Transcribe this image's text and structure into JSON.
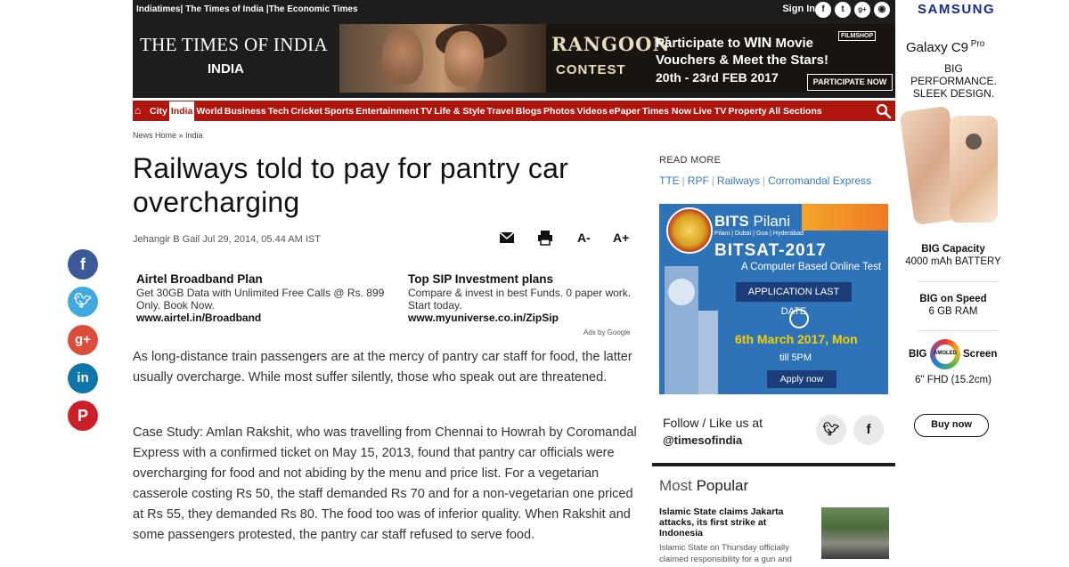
{
  "topbar": {
    "links": [
      "Indiatimes|",
      "The Times of India",
      "|The Economic Times"
    ],
    "signin": "Sign In",
    "social_icons": [
      "facebook-icon",
      "twitter-icon",
      "google-plus-icon",
      "rss-icon"
    ]
  },
  "masthead": {
    "title": "THE TIMES OF INDIA",
    "edition": "INDIA"
  },
  "banner": {
    "movie": "RANGOON",
    "contest": "CONTEST",
    "promo_line1_pre": "Participate to ",
    "promo_win": "WIN",
    "promo_line1_post": " Movie",
    "promo_line2": "Vouchers & Meet the Stars!",
    "dates": "20th - 23rd FEB 2017",
    "sponsor": "FILMSHOP",
    "cta": "PARTICIPATE NOW"
  },
  "nav": {
    "items": [
      "City",
      "India",
      "World",
      "Business",
      "Tech",
      "Cricket",
      "Sports",
      "Entertainment",
      "TV",
      "Life & Style",
      "Travel",
      "Blogs",
      "Photos",
      "Videos",
      "ePaper",
      "Times Now",
      "Live TV",
      "Property",
      "All Sections"
    ],
    "active": "India",
    "colors": {
      "nav_bg": "#b0150e"
    }
  },
  "breadcrumb": "News Home » India",
  "article": {
    "headline": "Railways told to pay for pantry car overcharging",
    "byline": "Jehangir B Gail Jul 29, 2014, 05.44 AM IST",
    "tools": {
      "font_down": "A-",
      "font_up": "A+"
    },
    "paragraphs": [
      "As long-distance train passengers are at the mercy of pantry car staff for food, the latter usually overcharge. While most suffer silently, those who speak out are threatened.",
      "Case Study: Amlan Rakshit, who was travelling from Chennai to Howrah by Coromandal Express with a confirmed ticket on May 15, 2013, found that pantry car officials were overcharging for food and not abiding by the menu and price list. For a vegetarian casserole costing Rs 50, the staff demanded Rs 70 and for a non-vegetarian one priced at Rs 55, they demanded Rs 80. The food too was of inferior quality. When Rakshit and some passengers protested, the pantry car staff refused to serve food."
    ]
  },
  "ads": [
    {
      "title": "Airtel Broadband Plan",
      "desc": "Get 30GB Data with Unlimited Free Calls @ Rs. 899 Only. Book Now.",
      "url": "www.airtel.in/Broadband"
    },
    {
      "title": "Top SIP Investment plans",
      "desc": "Compare & invest in best Funds. 0 paper work. Start today.",
      "url": "www.myuniverse.co.in/ZipSip"
    }
  ],
  "ads_by": "Ads by Google",
  "read_more": {
    "title": "READ MORE",
    "links": [
      "TTE",
      "RPF",
      "Railways",
      "Corromandal Express"
    ]
  },
  "bits_ad": {
    "name": "BITS",
    "name2": " Pilani",
    "campuses": "Pilani | Dubai | Goa | Hyderabad",
    "exam": "BITSAT-2017",
    "subtitle": "A Computer Based Online Test",
    "last_date_label": "APPLICATION LAST DATE",
    "date": "6th March 2017, Mon",
    "time": "till 5PM",
    "cta": "Apply now"
  },
  "follow": {
    "line1": "Follow / Like us at",
    "handle": "@timesofindia"
  },
  "most_popular": {
    "title_a": "Most",
    "title_b": " Popular",
    "headline": "Islamic State claims Jakarta attacks, its first strike at Indonesia",
    "summary": "Islamic State on Thursday officially claimed responsibility for a gun and"
  },
  "samsung_ad": {
    "brand": "SAMSUNG",
    "model": "Galaxy C9",
    "model_sup": " Pro",
    "tagline": "BIG PERFORMANCE. SLEEK DESIGN.",
    "spec1_title": "BIG Capacity",
    "spec1_value": "4000 mAh BATTERY",
    "spec2_title": "BIG on Speed",
    "spec2_value": "6 GB RAM",
    "spec3_pre": "BIG",
    "spec3_post": "Screen",
    "spec3_logo": "AMOLED",
    "spec3_value": "6\" FHD (15.2cm)",
    "cta": "Buy now"
  },
  "colors": {
    "header_bg": "#1d1d1d",
    "nav_red": "#b0150e",
    "link_blue": "#3a7ab8",
    "bits_blue": "#2e72b8",
    "samsung_blue": "#1428a0"
  }
}
